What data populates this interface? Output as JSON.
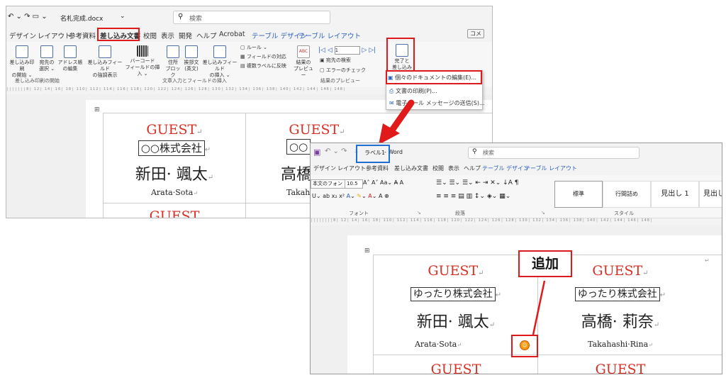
{
  "window1": {
    "title_filename": "名札完成.docx",
    "search_placeholder": "検索",
    "tabs": [
      "デザイン",
      "レイアウト",
      "参考資料",
      "差し込み文書",
      "校閲",
      "表示",
      "開発",
      "ヘルプ",
      "Acrobat",
      "テーブル デザイン",
      "テーブル レイアウト"
    ],
    "active_tab": "差し込み文書",
    "comment_label": "コメ",
    "ribbon": {
      "start_btns": [
        {
          "l1": "差し込み印刷",
          "l2": "の開始 ⌄"
        },
        {
          "l1": "宛先の",
          "l2": "選択 ⌄"
        },
        {
          "l1": "アドレス帳",
          "l2": "の編集"
        }
      ],
      "fields_btns": [
        {
          "l1": "差し込みフィールド",
          "l2": "の強調表示"
        },
        {
          "l1": "バーコード",
          "l2": "フィールドの挿入 ⌄"
        },
        {
          "l1": "住所",
          "l2": "ブロック"
        },
        {
          "l1": "挨拶文",
          "l2": "(英文)"
        },
        {
          "l1": "差し込みフィールド",
          "l2": "の挿入 ⌄"
        }
      ],
      "small_btns": [
        "ルール ⌄",
        "フィールドの対応",
        "複数ラベルに反映"
      ],
      "preview_btn": {
        "l1": "結果の",
        "l2": "プレビュー"
      },
      "preview_small": [
        "宛先の検索",
        "エラーのチェック"
      ],
      "nav_value": "1",
      "finish_btn": {
        "l1": "完了と",
        "l2": "差し込み ⌄"
      },
      "group_labels": [
        "差し込み印刷の開始",
        "文章入力とフィールドの挿入",
        "結果のプレビュー"
      ]
    },
    "dropdown": [
      "個々のドキュメントの編集(E)...",
      "文書の印刷(P)...",
      "電子メール メッセージの送信(S)..."
    ],
    "labels": [
      {
        "guest": "GUEST",
        "company": "○○株式会社",
        "name": "新田· 颯太",
        "romaji": "Arata·Sota"
      },
      {
        "guest": "GUEST",
        "company": "○○",
        "name": "高橋",
        "romaji": "Takah"
      }
    ],
    "next_guest": "GUEST"
  },
  "window2": {
    "doc_name": "ラベル1",
    "app_name": "Word",
    "search_placeholder": "検索",
    "tabs": [
      "デザイン",
      "レイアウト",
      "参考資料",
      "差し込み文書",
      "校閲",
      "表示",
      "ヘルプ",
      "テーブル デザイン",
      "テーブル レイアウト"
    ],
    "font_name": "本文のフォン",
    "font_size": "10.5",
    "group_labels": [
      "フォント",
      "段落",
      "スタイル"
    ],
    "styles": [
      "標準",
      "行間詰め",
      "見出し 1",
      "見出し"
    ],
    "labels": [
      {
        "guest": "GUEST",
        "company": "ゆったり株式会社",
        "name": "新田· 颯太",
        "romaji": "Arata·Sota"
      },
      {
        "guest": "GUEST",
        "company": "ゆったり株式会社",
        "name": "高橋· 莉奈",
        "romaji": "Takahashi·Rina"
      }
    ],
    "next_guest": "GUEST"
  },
  "callout_text": "追加",
  "colors": {
    "accent_red": "#e01a1a",
    "guest_red": "#d93025",
    "highlight_blue": "#1f6fd1",
    "word_blue": "#2b5fbf"
  }
}
